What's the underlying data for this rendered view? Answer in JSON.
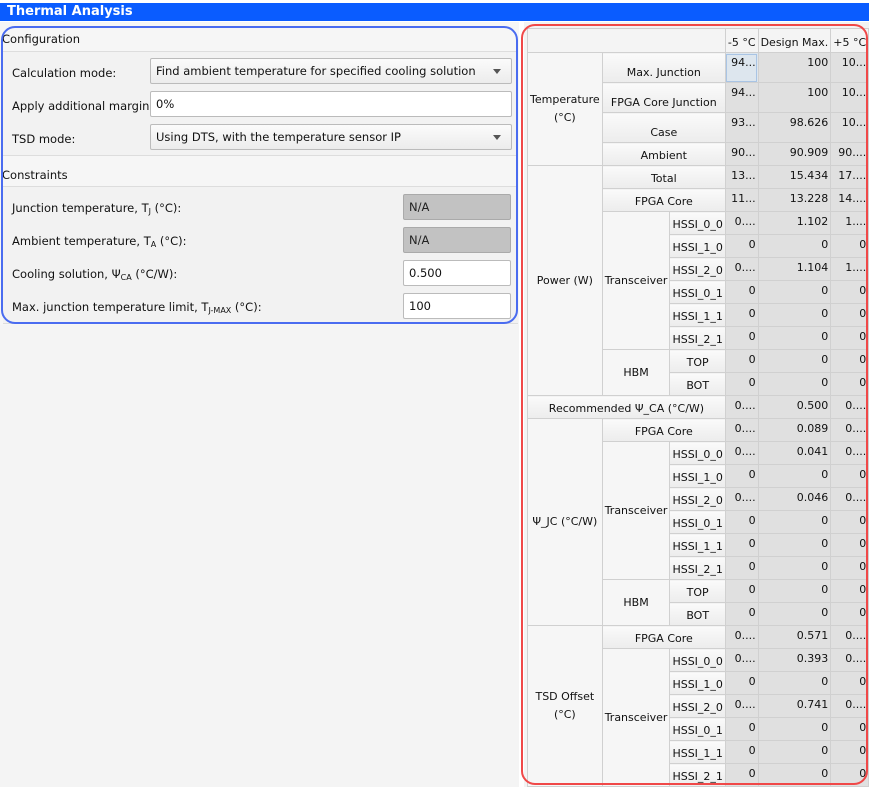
{
  "title": "Thermal Analysis",
  "configuration": {
    "heading": "Configuration",
    "calc_mode": {
      "label": "Calculation mode:",
      "value": "Find ambient temperature for specified cooling solution"
    },
    "margin": {
      "label": "Apply additional margin:",
      "value": "0%"
    },
    "tsd_mode": {
      "label": "TSD mode:",
      "value": "Using DTS, with the temperature sensor IP"
    }
  },
  "constraints": {
    "heading": "Constraints",
    "junction": {
      "label": "Junction temperature, T",
      "sub": "J",
      "suffix": " (°C):",
      "value": "N/A",
      "disabled": true
    },
    "ambient": {
      "label": "Ambient temperature, T",
      "sub": "A",
      "suffix": " (°C):",
      "value": "N/A",
      "disabled": true
    },
    "cooling": {
      "label": "Cooling solution, Ψ",
      "sub": "CA",
      "suffix": " (°C/W):",
      "value": "0.500"
    },
    "tjmax": {
      "label": "Max. junction temperature limit, T",
      "sub": "J-MAX",
      "suffix": " (°C):",
      "value": "100"
    }
  },
  "table": {
    "columns": [
      "-5 °C",
      "Design Max.",
      "+5 °C"
    ],
    "groups": [
      {
        "label": "Temperature (°C)",
        "children": [
          {
            "label": "Max. Junction",
            "values": [
              "94...",
              "100",
              "10..."
            ]
          },
          {
            "label": "FPGA Core Junction",
            "values": [
              "94...",
              "100",
              "10..."
            ]
          },
          {
            "label": "Case",
            "values": [
              "93...",
              "98.626",
              "10..."
            ]
          },
          {
            "label": "Ambient",
            "values": [
              "90...",
              "90.909",
              "90...."
            ]
          }
        ]
      },
      {
        "label": "Power (W)",
        "children": [
          {
            "label": "Total",
            "values": [
              "13...",
              "15.434",
              "17...."
            ]
          },
          {
            "label": "FPGA Core",
            "values": [
              "11...",
              "13.228",
              "14...."
            ]
          },
          {
            "label": "Transceiver",
            "children": [
              {
                "label": "HSSI_0_0",
                "values": [
                  "0....",
                  "1.102",
                  "1...."
                ]
              },
              {
                "label": "HSSI_1_0",
                "values": [
                  "0",
                  "0",
                  "0"
                ]
              },
              {
                "label": "HSSI_2_0",
                "values": [
                  "0....",
                  "1.104",
                  "1...."
                ]
              },
              {
                "label": "HSSI_0_1",
                "values": [
                  "0",
                  "0",
                  "0"
                ]
              },
              {
                "label": "HSSI_1_1",
                "values": [
                  "0",
                  "0",
                  "0"
                ]
              },
              {
                "label": "HSSI_2_1",
                "values": [
                  "0",
                  "0",
                  "0"
                ]
              }
            ]
          },
          {
            "label": "HBM",
            "children": [
              {
                "label": "TOP",
                "values": [
                  "0",
                  "0",
                  "0"
                ]
              },
              {
                "label": "BOT",
                "values": [
                  "0",
                  "0",
                  "0"
                ]
              }
            ]
          }
        ]
      },
      {
        "label": "Recommended Ψ_CA (°C/W)",
        "values": [
          "0....",
          "0.500",
          "0...."
        ]
      },
      {
        "label": "Ψ_JC (°C/W)",
        "children": [
          {
            "label": "FPGA Core",
            "values": [
              "0....",
              "0.089",
              "0...."
            ]
          },
          {
            "label": "Transceiver",
            "children": [
              {
                "label": "HSSI_0_0",
                "values": [
                  "0....",
                  "0.041",
                  "0...."
                ]
              },
              {
                "label": "HSSI_1_0",
                "values": [
                  "0",
                  "0",
                  "0"
                ]
              },
              {
                "label": "HSSI_2_0",
                "values": [
                  "0....",
                  "0.046",
                  "0...."
                ]
              },
              {
                "label": "HSSI_0_1",
                "values": [
                  "0",
                  "0",
                  "0"
                ]
              },
              {
                "label": "HSSI_1_1",
                "values": [
                  "0",
                  "0",
                  "0"
                ]
              },
              {
                "label": "HSSI_2_1",
                "values": [
                  "0",
                  "0",
                  "0"
                ]
              }
            ]
          },
          {
            "label": "HBM",
            "children": [
              {
                "label": "TOP",
                "values": [
                  "0",
                  "0",
                  "0"
                ]
              },
              {
                "label": "BOT",
                "values": [
                  "0",
                  "0",
                  "0"
                ]
              }
            ]
          }
        ]
      },
      {
        "label": "TSD Offset (°C)",
        "children": [
          {
            "label": "FPGA Core",
            "values": [
              "0....",
              "0.571",
              "0...."
            ]
          },
          {
            "label": "Transceiver",
            "children": [
              {
                "label": "HSSI_0_0",
                "values": [
                  "0....",
                  "0.393",
                  "0...."
                ]
              },
              {
                "label": "HSSI_1_0",
                "values": [
                  "0",
                  "0",
                  "0"
                ]
              },
              {
                "label": "HSSI_2_0",
                "values": [
                  "0....",
                  "0.741",
                  "0...."
                ]
              },
              {
                "label": "HSSI_0_1",
                "values": [
                  "0",
                  "0",
                  "0"
                ]
              },
              {
                "label": "HSSI_1_1",
                "values": [
                  "0",
                  "0",
                  "0"
                ]
              },
              {
                "label": "HSSI_2_1",
                "values": [
                  "0",
                  "0",
                  "0"
                ]
              }
            ]
          }
        ]
      }
    ]
  },
  "colors": {
    "title_bar": "#0a5cff",
    "annotation_left": "#4a6cf0",
    "annotation_right": "#f04848"
  }
}
